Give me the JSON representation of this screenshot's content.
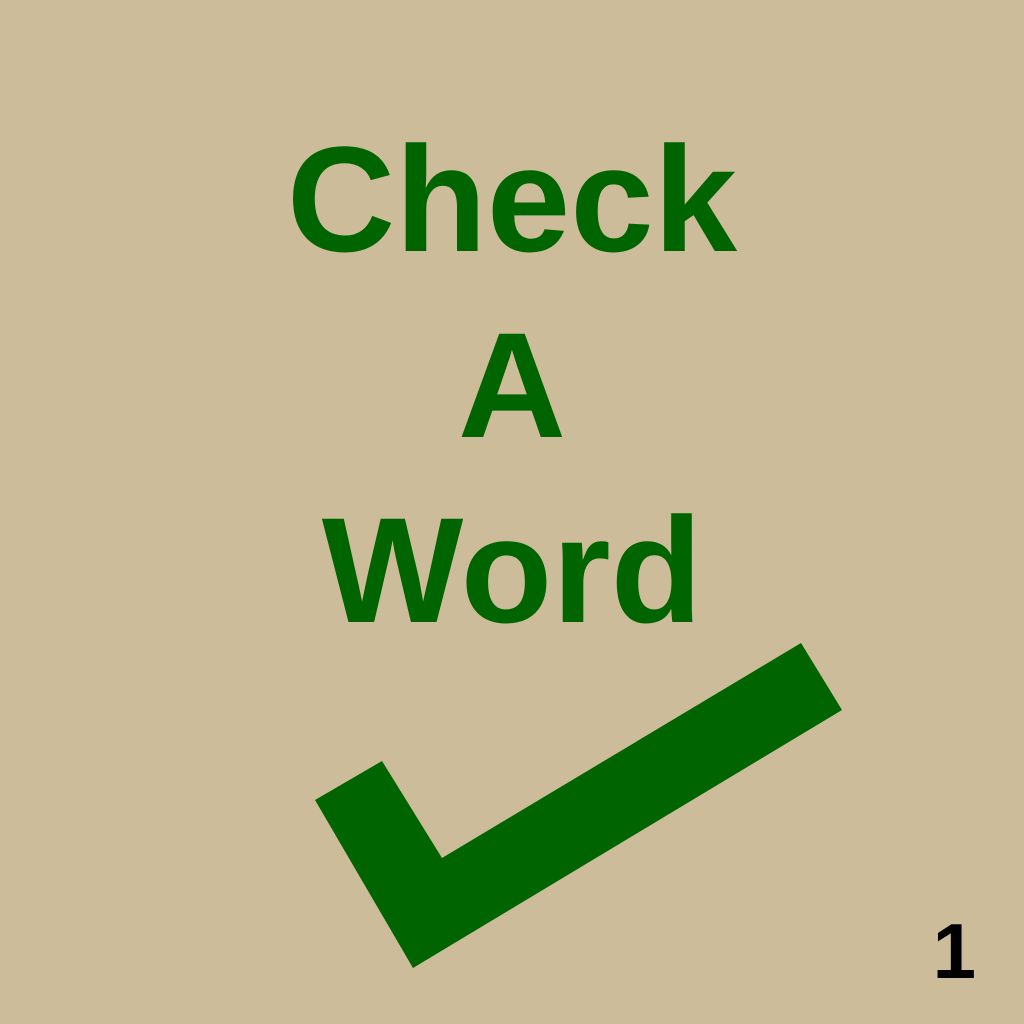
{
  "title": {
    "line1": "Check",
    "line2": "A",
    "line3": "Word"
  },
  "page_number": "1",
  "icon": "checkmark-icon",
  "colors": {
    "background": "#cdbc9a",
    "title": "#006400",
    "checkmark": "#006400",
    "page_number": "#000000"
  }
}
